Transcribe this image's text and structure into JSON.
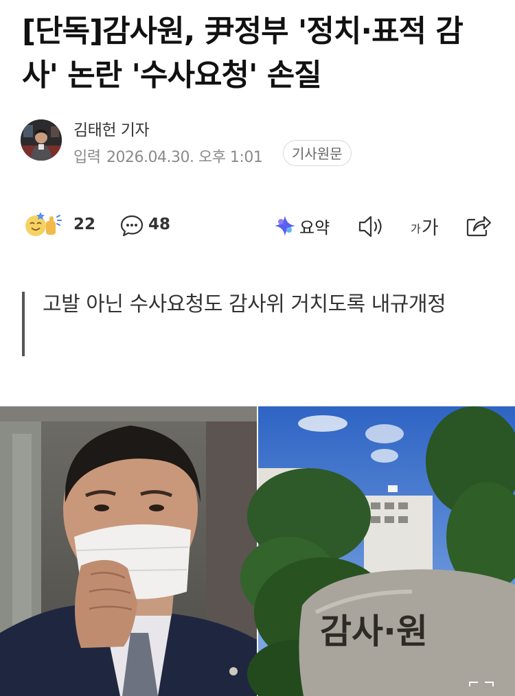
{
  "article": {
    "headline": "[단독]감사원, 尹정부 '정치·표적 감사' 논란 '수사요청' 손질",
    "reporter": "김태헌 기자",
    "publish_label": "입력",
    "publish_time": "2026.04.30. 오후 1:01",
    "original_button": "기사원문",
    "subheadline": "고발 아닌 수사요청도 감사위 거치도록 내규개정"
  },
  "actions": {
    "reaction_count": "22",
    "comment_count": "48",
    "summary_label": "요약",
    "font_size_small": "가",
    "font_size_large": "가"
  },
  "photo": {
    "stone_text": "감사·원"
  },
  "colors": {
    "text": "#111111",
    "meta": "#8a8a8a",
    "summary_star": "#5b5ff0"
  }
}
